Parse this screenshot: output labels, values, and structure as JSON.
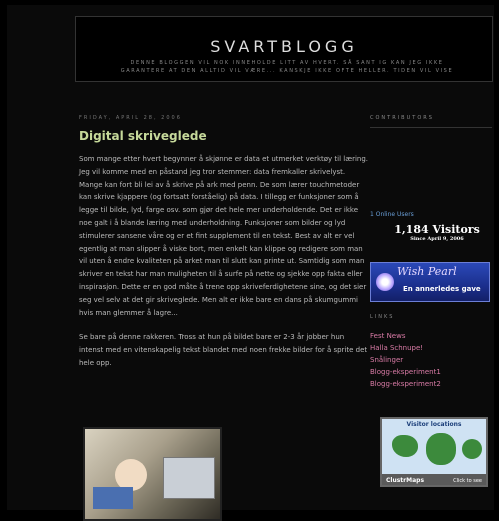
{
  "header": {
    "title": "SVARTBLOGG",
    "description_line1": "DENNE BLOGGEN VIL NOK INNEHOLDE LITT AV HVERT. SÅ SANT IG KAN JEG IKKE",
    "description_line2": "GARANTERE AT DEN ALLTID VIL VÆRE... KANSKJE IKKE OFTE HELLER. TIDEN VIL VISE"
  },
  "post": {
    "date": "FRIDAY, APRIL 28, 2006",
    "title": "Digital skriveglede",
    "paragraphs": [
      "Som mange etter hvert begynner å skjønne er data et utmerket verktøy til læring. Jeg vil komme med en påstand jeg tror stemmer: data fremkaller skrivelyst. Mange kan fort bli lei av å skrive på ark med penn. De som lærer touchmetoder kan skrive kjappere (og fortsatt forståelig) på data. I tillegg er funksjoner som å legge til bilde, lyd, farge osv. som gjør det hele mer underholdende. Det er ikke noe galt i å blande læring med underholdning. Funksjoner som bilder og lyd stimulerer sansene våre og er et fint supplement til en tekst. Best av alt er vel egentlig at man slipper å viske bort, men enkelt kan klippe og redigere som man vil uten å endre kvaliteten på arket man til slutt kan printe ut. Samtidig som man skriver en tekst har man muligheten til å surfe på nette og sjekke opp fakta eller inspirasjon. Dette er en god måte å trene opp skriveferdighetene sine, og det sier seg vel selv at det gir skriveglede. Men alt er ikke bare en dans på skumgummi hvis man glemmer å lagre...",
      "Se bare på denne rakkeren. Tross at hun på bildet bare er 2-3 år jobber hun intenst med en vitenskapelig tekst blandet med noen frekke bilder for å sprite det hele opp."
    ]
  },
  "sidebar": {
    "contributors_heading": "CONTRIBUTORS",
    "online_users": "1 Online Users",
    "visitors_count": "1,184 Visitors",
    "visitors_since": "Since April 9, 2006",
    "banner_script": "Wish Pearl",
    "banner_text": "En annerledes gave",
    "links_heading": "LINKS",
    "links": [
      "Fest News",
      "Halla Schnupe!",
      "Snålinger",
      "Blogg-eksperiment1",
      "Blogg-eksperiment2"
    ],
    "map_title": "Visitor locations",
    "map_brand": "ClustrMaps",
    "map_click": "Click to see"
  },
  "colors": {
    "background": "#000000",
    "post_title": "#c6d99a",
    "link": "#d97ba6",
    "online": "#6a9fd8"
  }
}
